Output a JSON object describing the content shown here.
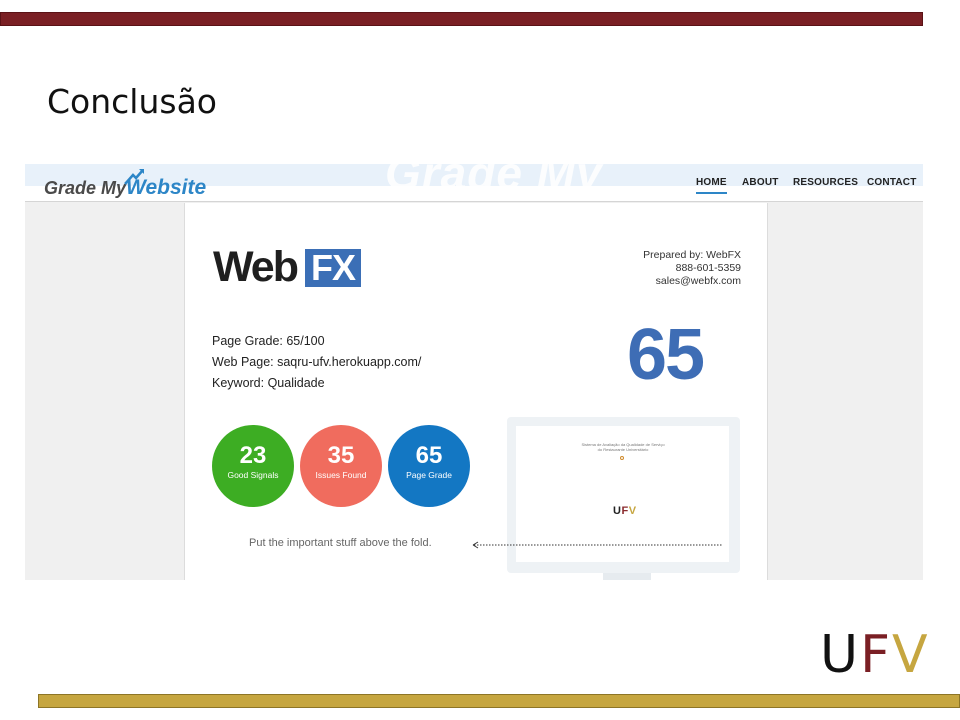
{
  "slide": {
    "title": "Conclusão",
    "accent_top": "#7a1f24",
    "accent_bottom": "#c6a640"
  },
  "site": {
    "brand_part1": "Grade My",
    "brand_part2": "Website",
    "watermark": "Grade My",
    "nav": [
      {
        "label": "HOME",
        "active": true
      },
      {
        "label": "ABOUT",
        "active": false
      },
      {
        "label": "RESOURCES",
        "active": false
      },
      {
        "label": "CONTACT",
        "active": false
      }
    ]
  },
  "report": {
    "logo_text1": "Web",
    "logo_text2": "FX",
    "prepared_by": "Prepared by: WebFX",
    "phone": "888-601-5359",
    "email": "sales@webfx.com",
    "page_grade_line": "Page Grade: 65/100",
    "web_page_line": "Web Page: saqru-ufv.herokuapp.com/",
    "keyword_line": "Keyword: Qualidade",
    "big_score": "65",
    "circles": [
      {
        "value": "23",
        "label": "Good Signals",
        "color": "#3dad23"
      },
      {
        "value": "35",
        "label": "Issues Found",
        "color": "#f06c5e"
      },
      {
        "value": "65",
        "label": "Page Grade",
        "color": "#1377c3"
      }
    ],
    "fold_text": "Put the important stuff above the fold.",
    "monitor_caption_line1": "Sistema de Avaliação da Qualidade de Serviço",
    "monitor_caption_line2": "do Restaurante Universitário",
    "monitor_logo": {
      "u": "U",
      "f": "F",
      "v": "V"
    }
  },
  "corner_logo": {
    "u": "U",
    "f": "F",
    "v": "V"
  }
}
